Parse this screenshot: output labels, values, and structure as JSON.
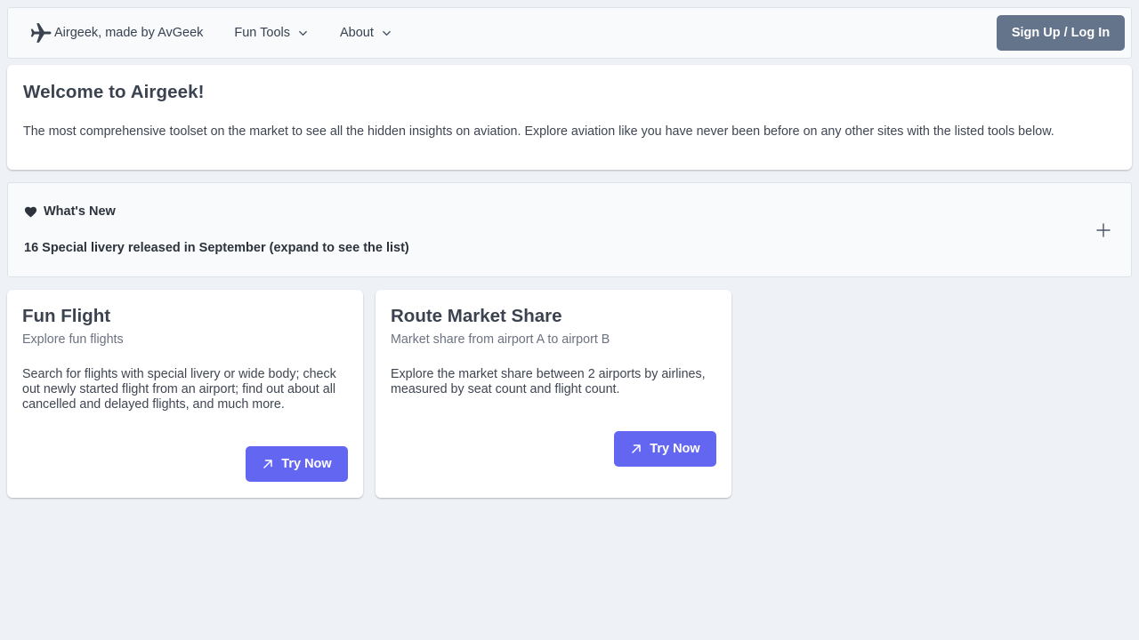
{
  "navbar": {
    "brand": "Airgeek, made by AvGeek",
    "brand_icon": "airplane-icon",
    "menus": [
      {
        "label": "Fun Tools",
        "icon": "chevron-down-icon"
      },
      {
        "label": "About",
        "icon": "chevron-down-icon"
      }
    ],
    "signup_label": "Sign Up / Log In"
  },
  "welcome": {
    "title": "Welcome to Airgeek!",
    "body": "The most comprehensive toolset on the market to see all the hidden insights on aviation. Explore aviation like you have never been before on any other sites with the listed tools below."
  },
  "whats_new": {
    "title": "What's New",
    "icon": "heart-icon",
    "summary": "16 Special livery released in September (expand to see the list)",
    "expand_icon": "plus-icon"
  },
  "cards": [
    {
      "title": "Fun Flight",
      "subtitle": "Explore fun flights",
      "description": "Search for flights with special livery or wide body; check out newly started flight from an airport; find out about all cancelled and delayed flights, and much more.",
      "button": "Try Now",
      "button_icon": "arrow-up-right-icon"
    },
    {
      "title": "Route Market Share",
      "subtitle": "Market share from airport A to airport B",
      "description": "Explore the market share between 2 airports by airlines, measured by seat count and flight count.",
      "button": "Try Now",
      "button_icon": "arrow-up-right-icon"
    }
  ],
  "colors": {
    "page_bg": "#eef2f7",
    "accent": "#6366f1",
    "secondary_button": "#64748b",
    "text": "#374151"
  }
}
